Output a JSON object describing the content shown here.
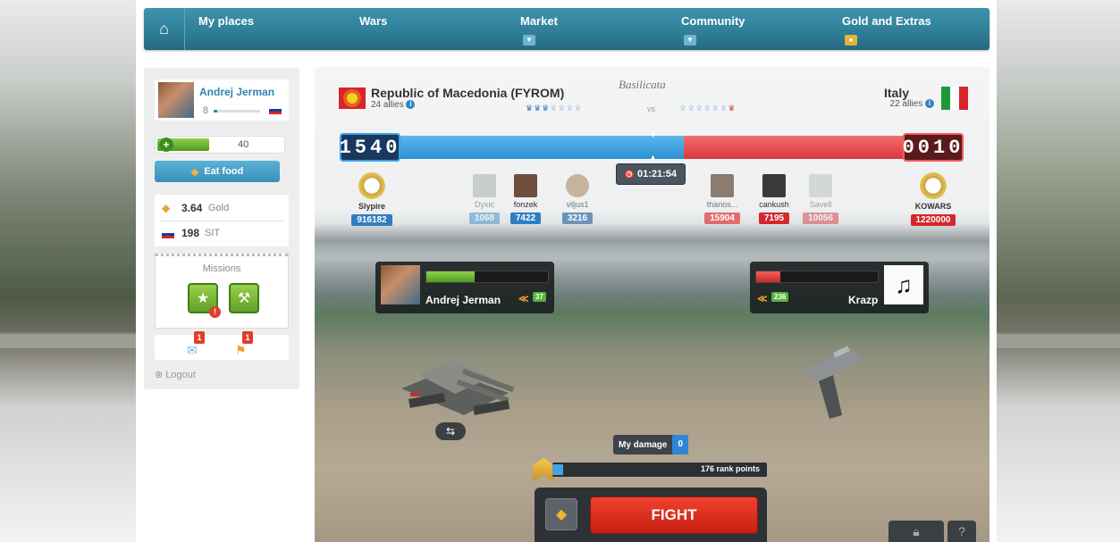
{
  "nav": {
    "items": [
      {
        "label": "My places",
        "has_caret": false
      },
      {
        "label": "Wars",
        "has_caret": false
      },
      {
        "label": "Market",
        "has_caret": true
      },
      {
        "label": "Community",
        "has_caret": true
      },
      {
        "label": "Gold and Extras",
        "has_caret": true
      }
    ]
  },
  "sidebar": {
    "user_name": "Andrej Jerman",
    "level": "8",
    "health": "40",
    "eat_food_label": "Eat food",
    "gold_value": "3.64",
    "gold_label": "Gold",
    "currency_value": "198",
    "currency_label": "SIT",
    "missions_label": "Missions",
    "mission_badge": "!",
    "messages_badge": "1",
    "alerts_badge": "1",
    "logout_label": "Logout"
  },
  "battle": {
    "region": "Basilicata",
    "left_country": {
      "name": "Republic of Macedonia (FYROM)",
      "allies": "24 allies"
    },
    "right_country": {
      "name": "Italy",
      "allies": "22 allies"
    },
    "vs_label": "vs",
    "score_left": "1540",
    "score_right": "0010",
    "timer": "01:21:54",
    "left_fighters": [
      {
        "name": "Slypire",
        "damage": "916182",
        "top": true
      },
      {
        "name": "Dyxic",
        "damage": "1068",
        "faded": true
      },
      {
        "name": "fonzek",
        "damage": "7422"
      },
      {
        "name": "viljus1",
        "damage": "3216"
      }
    ],
    "right_fighters": [
      {
        "name": "thanos...",
        "damage": "15904"
      },
      {
        "name": "cankush",
        "damage": "7195"
      },
      {
        "name": "Savell",
        "damage": "10056",
        "faded": true
      },
      {
        "name": "KOWARS",
        "damage": "1220000",
        "top": true
      }
    ],
    "player_left": {
      "name": "Andrej Jerman",
      "level": "37",
      "hp_fraction": 0.4
    },
    "player_right": {
      "name": "Krazp",
      "level": "236",
      "hp_fraction": 0.2
    },
    "my_damage_label": "My damage",
    "my_damage_value": "0",
    "rank_points_label": "176 rank points",
    "rank_fraction": 0.05,
    "fight_label": "FIGHT"
  },
  "colors": {
    "nav_blue": "#2f7d96",
    "left_side_blue": "#2c8fd2",
    "right_side_red": "#d8363c",
    "fight_red": "#e2321f"
  },
  "icons": [
    "home-icon",
    "food-icon",
    "gold-icon",
    "slovenia-flag-icon",
    "macedonia-flag-icon",
    "italy-flag-icon",
    "clock-icon",
    "swap-icon",
    "rank-icon",
    "lock-icon",
    "help-icon"
  ]
}
